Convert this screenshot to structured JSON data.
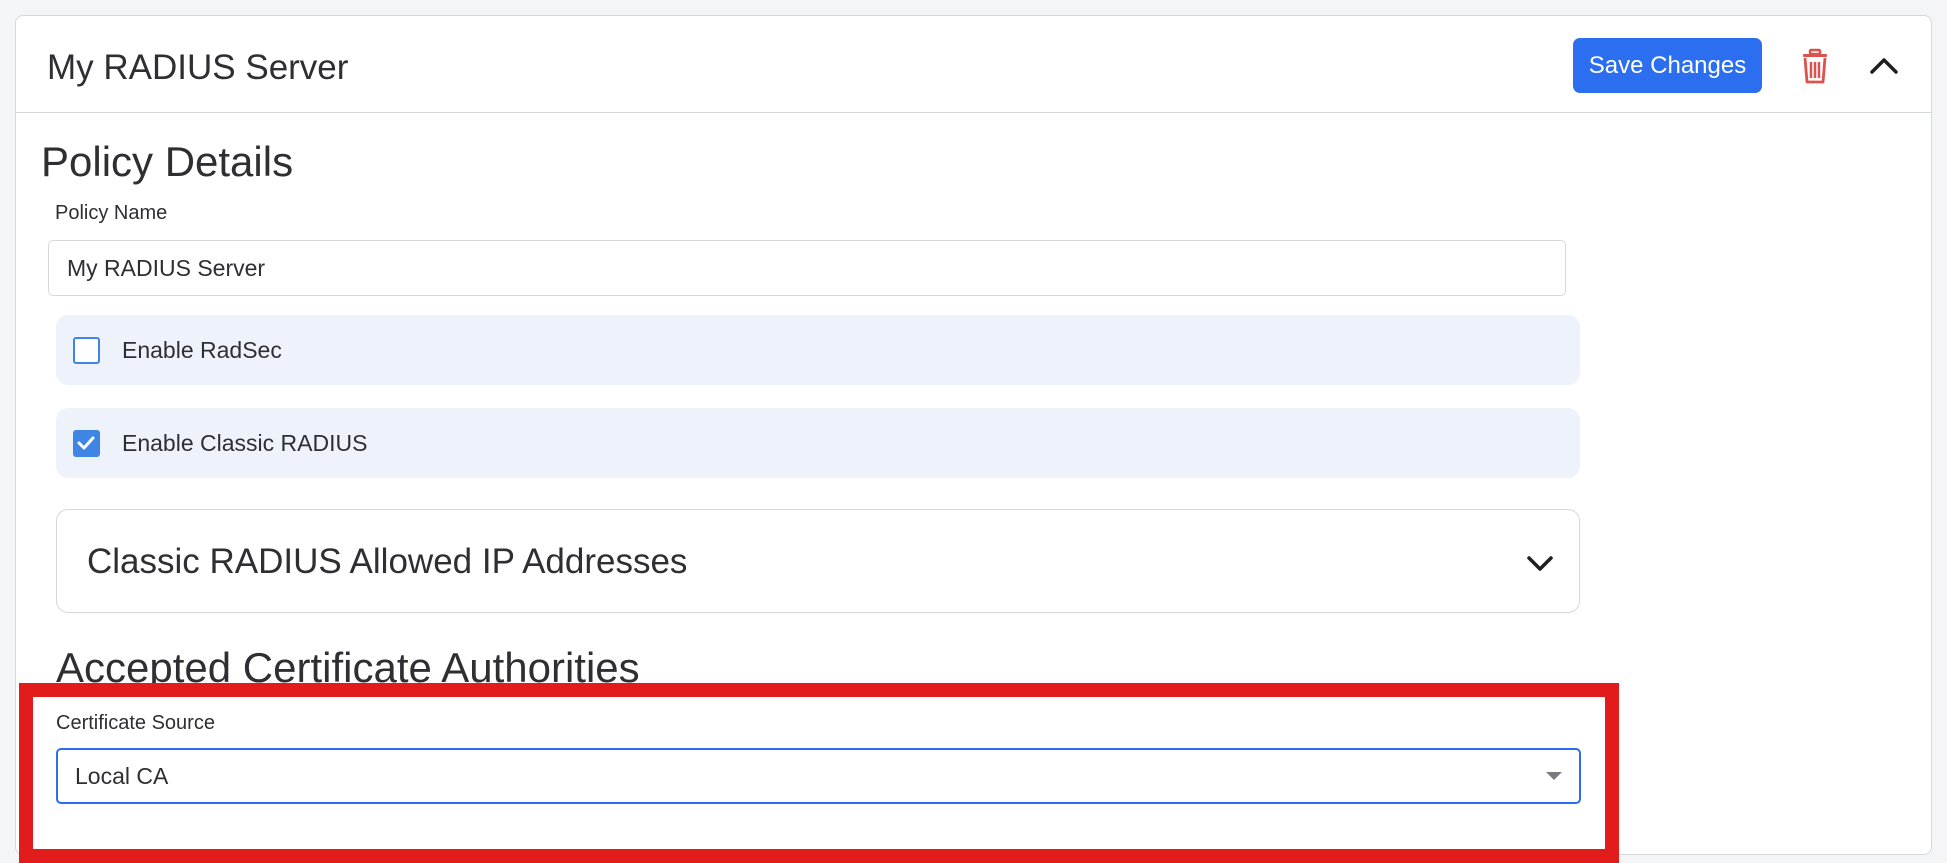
{
  "header": {
    "title": "My RADIUS Server",
    "save_label": "Save Changes",
    "delete_icon": "trash-icon",
    "collapse_icon": "chevron-up-icon"
  },
  "policy": {
    "section_title": "Policy Details",
    "name_label": "Policy Name",
    "name_value": "My RADIUS Server",
    "checkboxes": [
      {
        "label": "Enable RadSec",
        "checked": false
      },
      {
        "label": "Enable Classic RADIUS",
        "checked": true
      }
    ],
    "accordion_title": "Classic RADIUS Allowed IP Addresses",
    "accordion_icon": "chevron-down-icon"
  },
  "certificates": {
    "section_title": "Accepted Certificate Authorities",
    "source_label": "Certificate Source",
    "source_value": "Local CA"
  },
  "colors": {
    "accent": "#2b6ef0",
    "delete": "#d9534f",
    "highlight": "#e21b1b",
    "checkbox": "#3f85e3",
    "row_background": "#eef3fb"
  }
}
